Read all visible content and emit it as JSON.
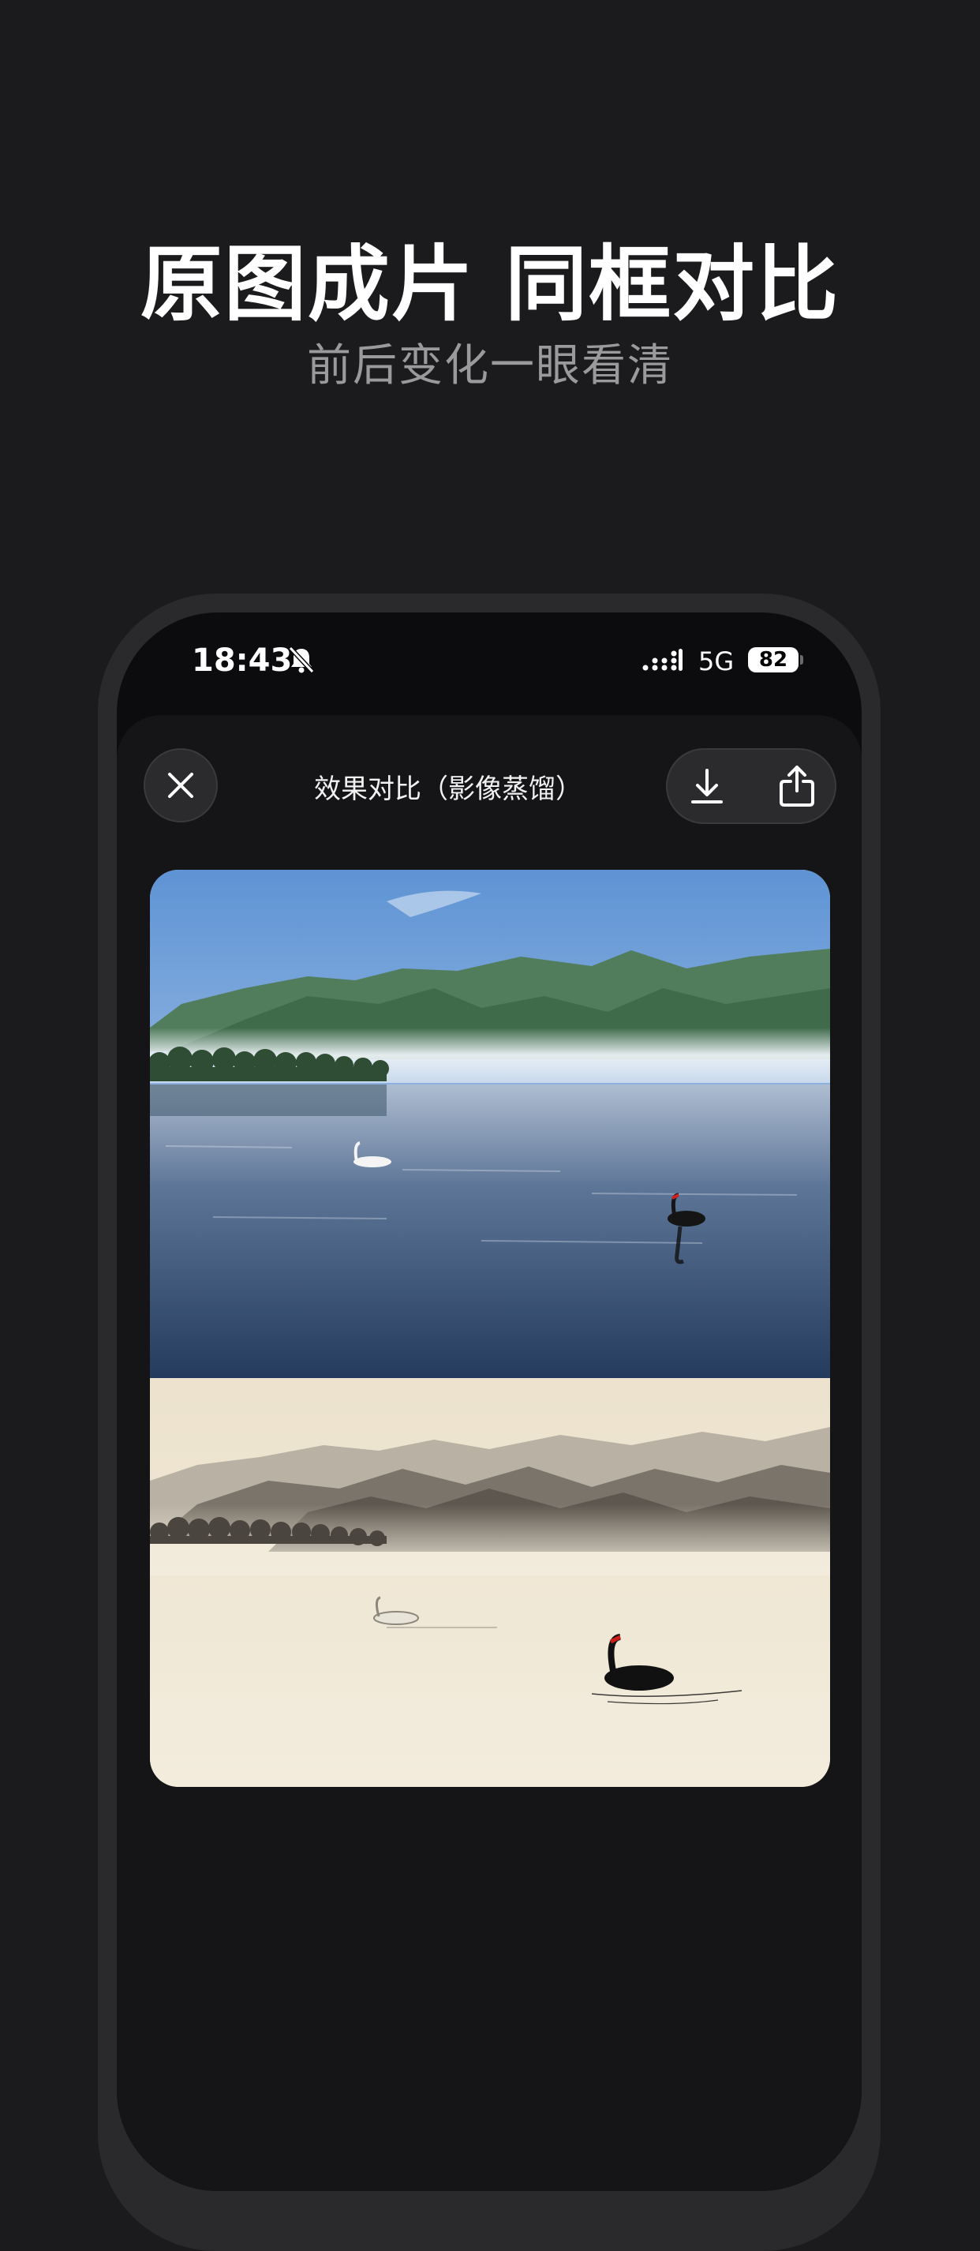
{
  "promo": {
    "headline": "原图成片 同框对比",
    "subheadline": "前后变化一眼看清"
  },
  "status_bar": {
    "time": "18:43",
    "network": "5G",
    "battery": "82"
  },
  "toolbar": {
    "title": "效果对比（影像蒸馏）"
  },
  "icons": {
    "close": "close-icon",
    "download": "download-icon",
    "share": "share-icon",
    "bell": "bell-slash-icon",
    "signal": "signal-icon"
  },
  "colors": {
    "background": "#1b1b1d",
    "sheet": "#151518",
    "subheadline": "#9a9a9d",
    "paper": "#efe7d6"
  }
}
